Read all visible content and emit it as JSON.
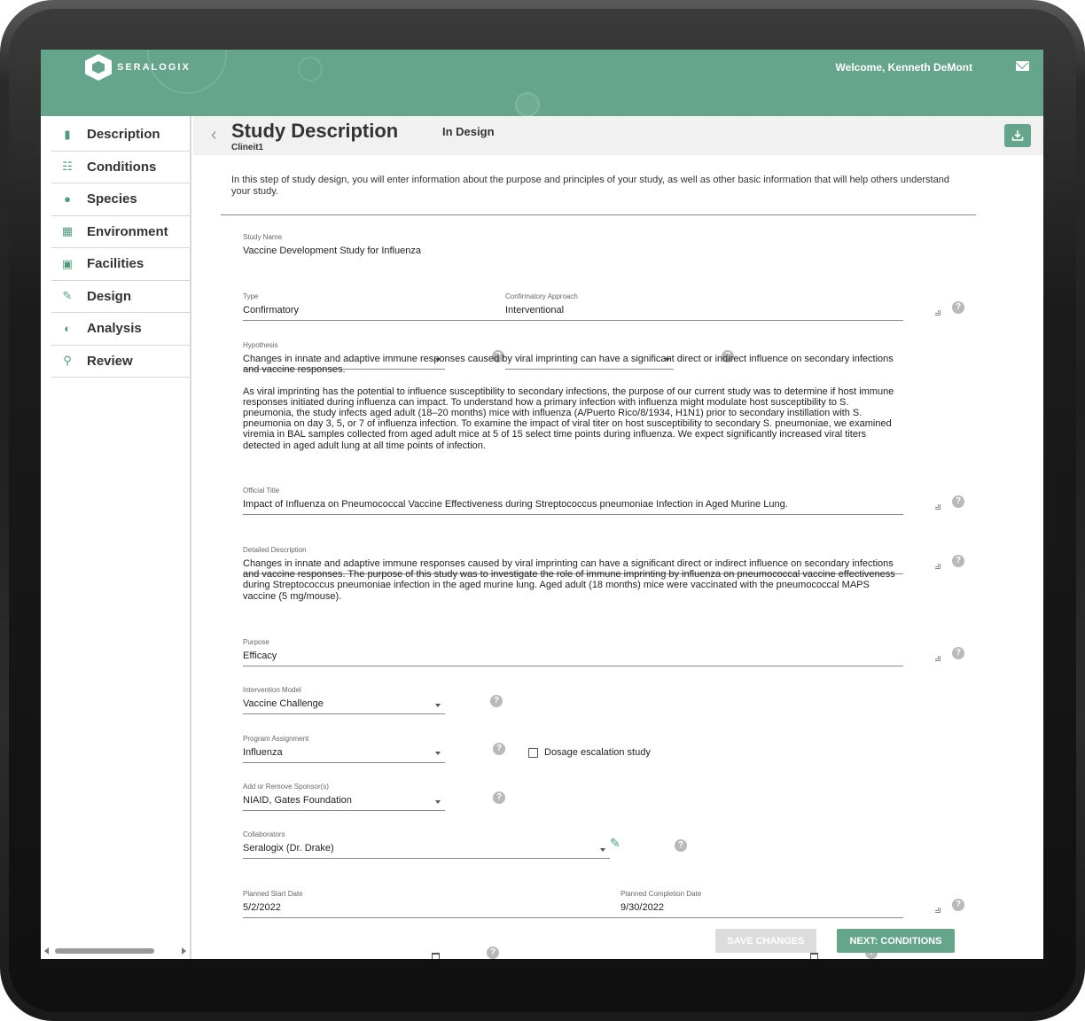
{
  "header": {
    "brand": "SERALOGIX",
    "welcome": "Welcome, Kenneth DeMont"
  },
  "sidebar": {
    "items": [
      {
        "label": "Description",
        "icon": "document-icon"
      },
      {
        "label": "Conditions",
        "icon": "hierarchy-icon"
      },
      {
        "label": "Species",
        "icon": "paw-icon"
      },
      {
        "label": "Environment",
        "icon": "environment-icon"
      },
      {
        "label": "Facilities",
        "icon": "facility-icon"
      },
      {
        "label": "Design",
        "icon": "pencil-icon"
      },
      {
        "label": "Analysis",
        "icon": "analysis-icon"
      },
      {
        "label": "Review",
        "icon": "search-icon"
      }
    ]
  },
  "page": {
    "title": "Study Description",
    "subtitle": "Clineit1",
    "status": "In Design",
    "intro": "In this step of study design, you will enter information about the purpose and principles of your study, as well as other basic information that will help others understand your study."
  },
  "form": {
    "study_name": {
      "label": "Study Name",
      "value": "Vaccine Development Study for Influenza"
    },
    "type": {
      "label": "Type",
      "value": "Confirmatory"
    },
    "confirmatory_approach": {
      "label": "Confirmatory Approach",
      "value": "Interventional"
    },
    "hypothesis": {
      "label": "Hypothesis",
      "value": "Changes in innate and adaptive immune responses caused by viral imprinting can have a significant direct or indirect influence on secondary infections and vaccine responses.\n\nAs viral imprinting has the potential to influence susceptibility to secondary infections, the purpose of our current study was to determine if host immune responses initiated during influenza can impact. To understand how a primary infection with influenza might modulate host susceptibility to S. pneumonia, the study infects aged adult (18–20 months) mice with influenza (A/Puerto Rico/8/1934, H1N1) prior to secondary instillation with S. pneumonia on day 3, 5, or 7 of influenza infection. To examine the impact of viral titer on host susceptibility to secondary S. pneumoniae, we examined viremia in BAL samples collected from aged adult mice at 5 of 15 select time points during influenza. We expect significantly increased viral titers detected in aged adult lung at all time points of infection."
    },
    "official_title": {
      "label": "Official Title",
      "value": "Impact of Influenza on Pneumococcal Vaccine Effectiveness during Streptococcus pneumoniae Infection in Aged Murine Lung."
    },
    "detailed_description": {
      "label": "Detailed Description",
      "value": "Changes in innate and adaptive immune responses caused by viral imprinting can have a significant direct or indirect influence on secondary infections and vaccine responses. The purpose of this study was to investigate the role of immune imprinting by influenza on pneumococcal vaccine effectiveness during Streptococcus pneumoniae infection in the aged murine lung. Aged adult (18 months) mice were vaccinated with the pneumococcal MAPS vaccine (5 mg/mouse)."
    },
    "purpose": {
      "label": "Purpose",
      "value": "Efficacy"
    },
    "intervention_model": {
      "label": "Intervention Model",
      "value": "Vaccine Challenge"
    },
    "dosage_escalation": {
      "label": "Dosage escalation study",
      "checked": false
    },
    "program_assignment": {
      "label": "Program Assignment",
      "value": "Influenza"
    },
    "sponsors": {
      "label": "Add or Remove Sponsor(s)",
      "value": "NIAID, Gates Foundation"
    },
    "collaborators": {
      "label": "Collaborators",
      "value": "Seralogix (Dr. Drake)"
    },
    "start_date": {
      "label": "Planned Start Date",
      "value": "5/2/2022"
    },
    "completion_date": {
      "label": "Planned Completion Date",
      "value": "9/30/2022"
    }
  },
  "buttons": {
    "save": "SAVE CHANGES",
    "next": "NEXT: CONDITIONS"
  },
  "colors": {
    "brand": "#64a58c",
    "icon_accent": "#4e9d78"
  }
}
